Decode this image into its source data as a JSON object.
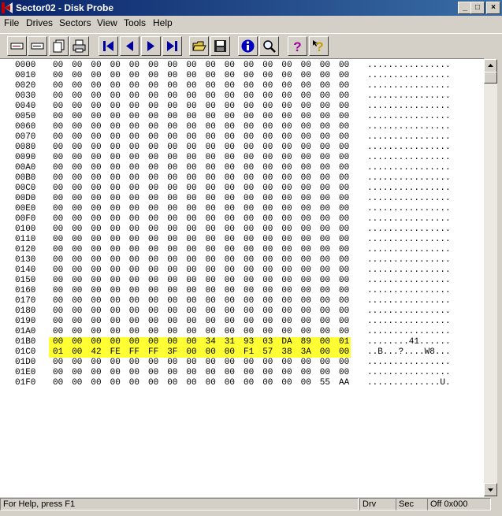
{
  "window": {
    "title": "Sector02 - Disk Probe",
    "minimize": "_",
    "maximize": "□",
    "close": "×"
  },
  "menu": [
    "File",
    "Drives",
    "Sectors",
    "View",
    "Tools",
    "Help"
  ],
  "toolbar": [
    {
      "name": "read-sector-button",
      "icon": "drive-icon"
    },
    {
      "name": "write-sector-button",
      "icon": "drive-icon"
    },
    {
      "name": "copy-sector-button",
      "icon": "pages-icon"
    },
    {
      "name": "print-button",
      "icon": "printer-icon"
    },
    {
      "name": "first-sector-button",
      "icon": "first-icon"
    },
    {
      "name": "previous-sector-button",
      "icon": "previous-icon"
    },
    {
      "name": "next-sector-button",
      "icon": "next-icon"
    },
    {
      "name": "last-sector-button",
      "icon": "last-icon"
    },
    {
      "name": "open-file-button",
      "icon": "open-folder-icon"
    },
    {
      "name": "save-button",
      "icon": "floppy-icon"
    },
    {
      "name": "info-button",
      "icon": "info-icon"
    },
    {
      "name": "find-button",
      "icon": "magnifier-icon"
    },
    {
      "name": "help-button",
      "icon": "help-icon"
    },
    {
      "name": "context-help-button",
      "icon": "context-help-icon"
    }
  ],
  "hex": {
    "highlight_rows": [
      "01B0",
      "01C0"
    ],
    "rows": [
      {
        "offset": "0000",
        "bytes": "00 00 00 00 00 00 00 00 00 00 00 00 00 00 00 00",
        "ascii": "................"
      },
      {
        "offset": "0010",
        "bytes": "00 00 00 00 00 00 00 00 00 00 00 00 00 00 00 00",
        "ascii": "................"
      },
      {
        "offset": "0020",
        "bytes": "00 00 00 00 00 00 00 00 00 00 00 00 00 00 00 00",
        "ascii": "................"
      },
      {
        "offset": "0030",
        "bytes": "00 00 00 00 00 00 00 00 00 00 00 00 00 00 00 00",
        "ascii": "................"
      },
      {
        "offset": "0040",
        "bytes": "00 00 00 00 00 00 00 00 00 00 00 00 00 00 00 00",
        "ascii": "................"
      },
      {
        "offset": "0050",
        "bytes": "00 00 00 00 00 00 00 00 00 00 00 00 00 00 00 00",
        "ascii": "................"
      },
      {
        "offset": "0060",
        "bytes": "00 00 00 00 00 00 00 00 00 00 00 00 00 00 00 00",
        "ascii": "................"
      },
      {
        "offset": "0070",
        "bytes": "00 00 00 00 00 00 00 00 00 00 00 00 00 00 00 00",
        "ascii": "................"
      },
      {
        "offset": "0080",
        "bytes": "00 00 00 00 00 00 00 00 00 00 00 00 00 00 00 00",
        "ascii": "................"
      },
      {
        "offset": "0090",
        "bytes": "00 00 00 00 00 00 00 00 00 00 00 00 00 00 00 00",
        "ascii": "................"
      },
      {
        "offset": "00A0",
        "bytes": "00 00 00 00 00 00 00 00 00 00 00 00 00 00 00 00",
        "ascii": "................"
      },
      {
        "offset": "00B0",
        "bytes": "00 00 00 00 00 00 00 00 00 00 00 00 00 00 00 00",
        "ascii": "................"
      },
      {
        "offset": "00C0",
        "bytes": "00 00 00 00 00 00 00 00 00 00 00 00 00 00 00 00",
        "ascii": "................"
      },
      {
        "offset": "00D0",
        "bytes": "00 00 00 00 00 00 00 00 00 00 00 00 00 00 00 00",
        "ascii": "................"
      },
      {
        "offset": "00E0",
        "bytes": "00 00 00 00 00 00 00 00 00 00 00 00 00 00 00 00",
        "ascii": "................"
      },
      {
        "offset": "00F0",
        "bytes": "00 00 00 00 00 00 00 00 00 00 00 00 00 00 00 00",
        "ascii": "................"
      },
      {
        "offset": "0100",
        "bytes": "00 00 00 00 00 00 00 00 00 00 00 00 00 00 00 00",
        "ascii": "................"
      },
      {
        "offset": "0110",
        "bytes": "00 00 00 00 00 00 00 00 00 00 00 00 00 00 00 00",
        "ascii": "................"
      },
      {
        "offset": "0120",
        "bytes": "00 00 00 00 00 00 00 00 00 00 00 00 00 00 00 00",
        "ascii": "................"
      },
      {
        "offset": "0130",
        "bytes": "00 00 00 00 00 00 00 00 00 00 00 00 00 00 00 00",
        "ascii": "................"
      },
      {
        "offset": "0140",
        "bytes": "00 00 00 00 00 00 00 00 00 00 00 00 00 00 00 00",
        "ascii": "................"
      },
      {
        "offset": "0150",
        "bytes": "00 00 00 00 00 00 00 00 00 00 00 00 00 00 00 00",
        "ascii": "................"
      },
      {
        "offset": "0160",
        "bytes": "00 00 00 00 00 00 00 00 00 00 00 00 00 00 00 00",
        "ascii": "................"
      },
      {
        "offset": "0170",
        "bytes": "00 00 00 00 00 00 00 00 00 00 00 00 00 00 00 00",
        "ascii": "................"
      },
      {
        "offset": "0180",
        "bytes": "00 00 00 00 00 00 00 00 00 00 00 00 00 00 00 00",
        "ascii": "................"
      },
      {
        "offset": "0190",
        "bytes": "00 00 00 00 00 00 00 00 00 00 00 00 00 00 00 00",
        "ascii": "................"
      },
      {
        "offset": "01A0",
        "bytes": "00 00 00 00 00 00 00 00 00 00 00 00 00 00 00 00",
        "ascii": "................"
      },
      {
        "offset": "01B0",
        "bytes": "00 00 00 00 00 00 00 00 34 31 93 03 DA 89 00 01",
        "ascii": "........41......"
      },
      {
        "offset": "01C0",
        "bytes": "01 00 42 FE FF FF 3F 00 00 00 F1 57 38 3A 00 00",
        "ascii": "..B...?....W8..."
      },
      {
        "offset": "01D0",
        "bytes": "00 00 00 00 00 00 00 00 00 00 00 00 00 00 00 00",
        "ascii": "................"
      },
      {
        "offset": "01E0",
        "bytes": "00 00 00 00 00 00 00 00 00 00 00 00 00 00 00 00",
        "ascii": "................"
      },
      {
        "offset": "01F0",
        "bytes": "00 00 00 00 00 00 00 00 00 00 00 00 00 00 55 AA",
        "ascii": "..............U."
      }
    ]
  },
  "status": {
    "help": "For Help, press F1",
    "drive": "Drv",
    "sector": "Sec",
    "offset": "Off 0x000"
  },
  "colors": {
    "titlebar": "#0a246a",
    "highlight": "#ffff33",
    "face": "#d4d0c8"
  }
}
